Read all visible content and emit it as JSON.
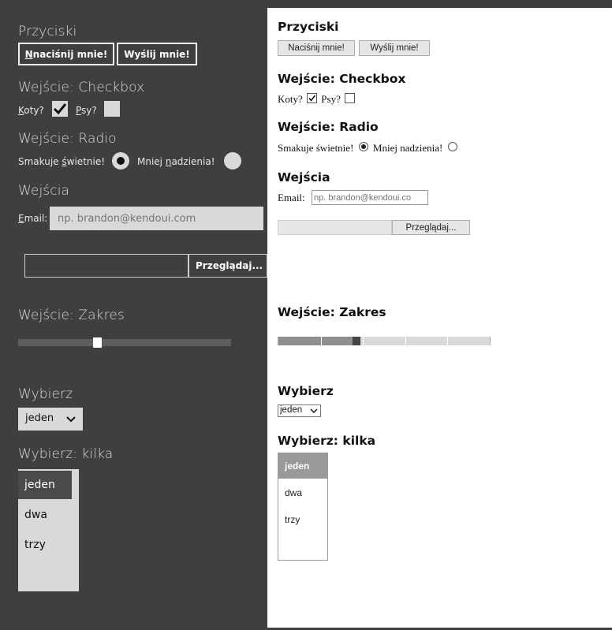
{
  "dark": {
    "buttons_heading": "Przyciski",
    "btn1_accel": "N",
    "btn1_rest": "naciśnij mnie!",
    "btn2": "Wyślij mnie!",
    "checkbox_heading": "Wejście: Checkbox",
    "cats_accel": "K",
    "cats_rest": "oty?",
    "cats_checked": true,
    "dogs_accel": "P",
    "dogs_rest": "sy?",
    "dogs_checked": false,
    "radio_heading": "Wejście: Radio",
    "radio1_pre": "Smakuje ",
    "radio1_accel": "ś",
    "radio1_post": "wietnie!",
    "radio1_checked": true,
    "radio2_pre": "Mniej ",
    "radio2_accel": "n",
    "radio2_post": "adzienia!",
    "radio2_checked": false,
    "inputs_heading": "Wejścia",
    "email_accel": "E",
    "email_rest": "mail:",
    "email_placeholder": "np. brandon@kendoui.com",
    "browse_label": "Przeglądaj...",
    "range_heading": "Wejście: Zakres",
    "range_value_fraction": 0.37,
    "select_heading": "Wybierz",
    "select_value": "jeden",
    "multi_heading": "Wybierz: kilka",
    "multi_options": [
      "jeden",
      "dwa",
      "trzy"
    ],
    "multi_selected": "jeden"
  },
  "light": {
    "buttons_heading": "Przyciski",
    "btn1": "Naciśnij mnie!",
    "btn2": "Wyślij mnie!",
    "checkbox_heading": "Wejście: Checkbox",
    "cats": "Koty?",
    "cats_checked": true,
    "dogs": "Psy?",
    "dogs_checked": false,
    "radio_heading": "Wejście: Radio",
    "radio1": "Smakuje świetnie!",
    "radio1_checked": true,
    "radio2": "Mniej nadzienia!",
    "radio2_checked": false,
    "inputs_heading": "Wejścia",
    "email_label": "Email:",
    "email_placeholder": "np. brandon@kendoui.co",
    "browse_label": "Przeglądaj...",
    "range_heading": "Wejście: Zakres",
    "range_value_fraction": 0.37,
    "select_heading": "Wybierz",
    "select_value": "jeden",
    "multi_heading": "Wybierz: kilka",
    "multi_options": [
      "jeden",
      "dwa",
      "trzy"
    ],
    "multi_selected": "jeden"
  },
  "colors": {
    "dark_bg": "#3f3f3f",
    "dark_control": "#d9d9d9",
    "dark_selected": "#4a4a4a",
    "light_selected": "#999999",
    "range_track_dark": "#5e5e5e"
  }
}
